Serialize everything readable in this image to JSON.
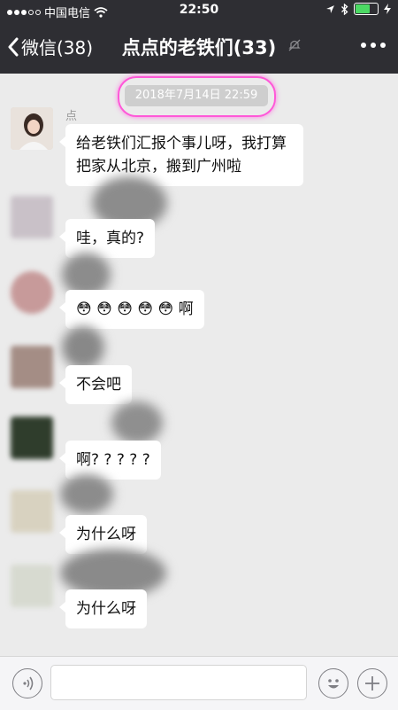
{
  "status": {
    "carrier": "中国电信",
    "time": "22:50"
  },
  "nav": {
    "back_label": "微信(38)",
    "title": "点点的老铁们(33)"
  },
  "chat": {
    "timestamp": "2018年7月14日  22:59",
    "messages": [
      {
        "sender": "点",
        "text": "给老铁们汇报个事儿呀，我打算把家从北京，搬到广州啦"
      },
      {
        "sender": "",
        "text": "哇，真的?"
      },
      {
        "sender": "",
        "text": "😳 😳 😳 😳 😳 啊"
      },
      {
        "sender": "",
        "text": "不会吧"
      },
      {
        "sender": "",
        "text": "啊? ? ? ? ?"
      },
      {
        "sender": "",
        "text": "为什么呀"
      },
      {
        "sender": "",
        "text": "为什么呀"
      }
    ]
  },
  "icons": [
    "back-chevron-icon",
    "mute-icon",
    "more-icon",
    "voice-icon",
    "emoji-icon",
    "plus-icon"
  ],
  "colors": {
    "nav_bg": "#2e2e33",
    "chat_bg": "#ebebeb",
    "highlight": "#ff58d8"
  }
}
